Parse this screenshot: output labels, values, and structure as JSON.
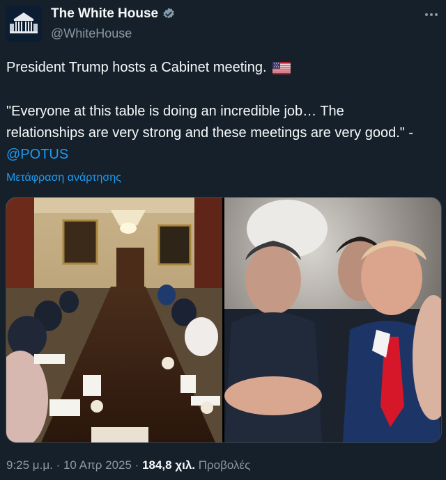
{
  "author": {
    "display_name": "The White House",
    "handle": "@WhiteHouse",
    "verified": true,
    "more_icon": "ellipsis-icon"
  },
  "post": {
    "line1": "President Trump hosts a Cabinet meeting.",
    "flag_icon": "us-flag-icon",
    "quote": "\"Everyone at this table is doing an incredible job… The relationships are very strong and these meetings are very good.\" - ",
    "mention": "@POTUS",
    "translate_label": "Μετάφραση ανάρτησης"
  },
  "media": {
    "photos": [
      "cabinet-room-photo",
      "president-speaking-photo"
    ]
  },
  "footer": {
    "time": "9:25 μ.μ.",
    "sep1": " · ",
    "date": "10 Απρ 2025",
    "sep2": " · ",
    "views_count": "184,8 χιλ.",
    "views_label": " Προβολές"
  },
  "colors": {
    "background": "#15202b",
    "text": "#f7f9f9",
    "secondary": "#8b98a5",
    "link": "#1d9bf0"
  }
}
